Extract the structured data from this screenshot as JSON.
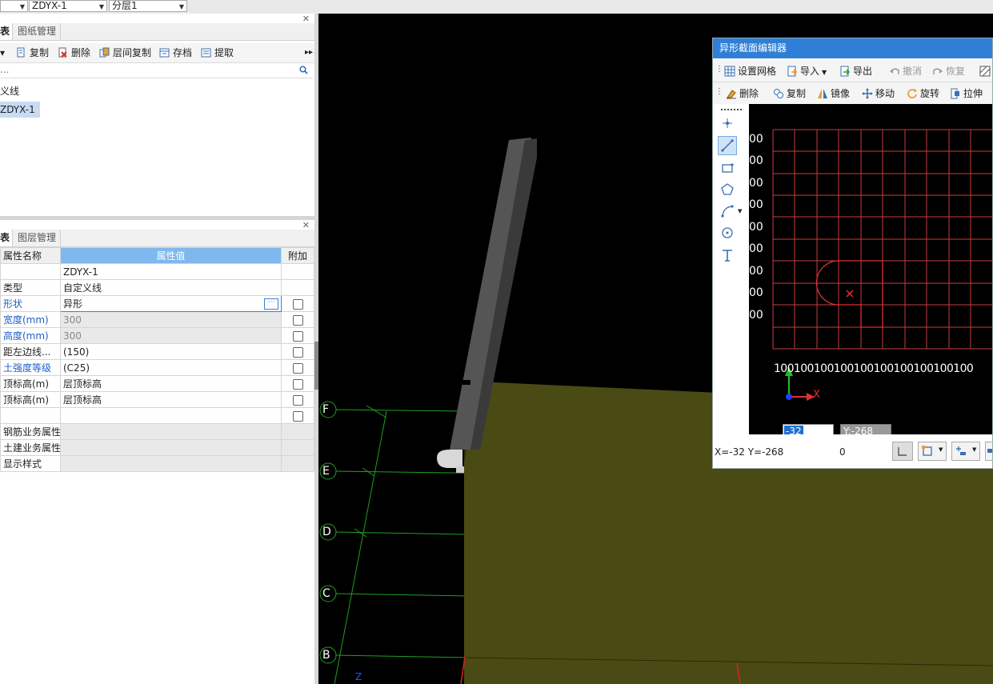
{
  "topbar": {
    "dd1": "",
    "dd2": "ZDYX-1",
    "dd3": "分层1"
  },
  "upper_panel": {
    "tabs": [
      "表",
      "图纸管理"
    ],
    "toolbar": [
      "复制",
      "删除",
      "层间复制",
      "存档",
      "提取"
    ],
    "search_placeholder": "...",
    "tree": [
      "义线",
      "ZDYX-1"
    ]
  },
  "lower_panel": {
    "tabs": [
      "表",
      "图层管理"
    ],
    "columns": [
      "属性名称",
      "属性值",
      "附加"
    ],
    "rows": [
      {
        "name": "",
        "value": "ZDYX-1"
      },
      {
        "name": "类型",
        "value": "自定义线"
      },
      {
        "name": "形状",
        "value": "异形"
      },
      {
        "name": "宽度(mm)",
        "value": "300"
      },
      {
        "name": "高度(mm)",
        "value": "300"
      },
      {
        "name": "距左边线...",
        "value": "(150)"
      },
      {
        "name": "土强度等级",
        "value": "(C25)"
      },
      {
        "name": "顶标高(m)",
        "value": "层顶标高"
      },
      {
        "name": "顶标高(m)",
        "value": "层顶标高"
      },
      {
        "name": "",
        "value": ""
      },
      {
        "name": "钢筋业务属性",
        "value": ""
      },
      {
        "name": "土建业务属性",
        "value": ""
      },
      {
        "name": "显示样式",
        "value": ""
      }
    ]
  },
  "viewport": {
    "axis_labels": [
      "F",
      "E",
      "D",
      "C",
      "B"
    ],
    "z_axis": "Z"
  },
  "editor": {
    "title": "异形截面编辑器",
    "toolbar1": [
      "设置网格",
      "导入",
      "导出",
      "撤消",
      "恢复"
    ],
    "toolbar2": [
      "删除",
      "复制",
      "镜像",
      "移动",
      "旋转",
      "拉伸"
    ],
    "y_labels": [
      "00",
      "00",
      "00",
      "00",
      "00",
      "00",
      "00",
      "00",
      "00"
    ],
    "x_labels": "100100100100100100100100100100",
    "x_input": "-32",
    "y_input": "Y:-268",
    "coord_text": "X=-32 Y=-268",
    "zero_text": "0"
  },
  "colors": {
    "grid": "#c83b3b",
    "shape": "#e03030",
    "title_bar": "#2f7fd6",
    "slab": "#4a4a14",
    "axis_green": "#1fa01f"
  }
}
